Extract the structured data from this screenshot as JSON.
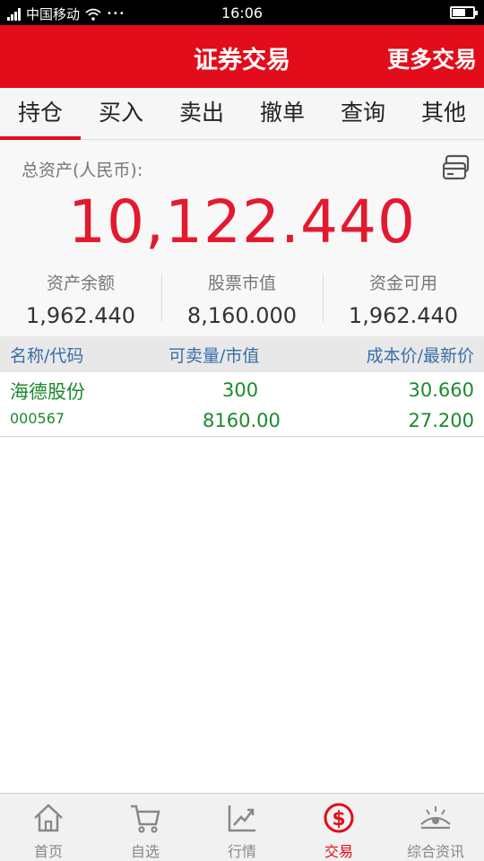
{
  "status_bar": {
    "carrier": "中国移动",
    "dots": "•••",
    "time": "16:06"
  },
  "header": {
    "title": "证券交易",
    "more_label": "更多交易"
  },
  "tabs": [
    {
      "label": "持仓",
      "active": true
    },
    {
      "label": "买入"
    },
    {
      "label": "卖出"
    },
    {
      "label": "撤单"
    },
    {
      "label": "查询"
    },
    {
      "label": "其他"
    }
  ],
  "summary": {
    "total_label": "总资产(人民币):",
    "total_value": "10,122.440",
    "stats": [
      {
        "label": "资产余额",
        "value": "1,962.440"
      },
      {
        "label": "股票市值",
        "value": "8,160.000"
      },
      {
        "label": "资金可用",
        "value": "1,962.440"
      }
    ]
  },
  "table": {
    "headers": [
      "名称/代码",
      "可卖量/市值",
      "成本价/最新价"
    ],
    "rows": [
      {
        "name": "海德股份",
        "code": "000567",
        "sellable": "300",
        "market_value": "8160.00",
        "cost_price": "30.660",
        "latest_price": "27.200"
      }
    ]
  },
  "bottom_nav": [
    {
      "label": "首页",
      "icon": "home-icon"
    },
    {
      "label": "自选",
      "icon": "cart-icon"
    },
    {
      "label": "行情",
      "icon": "trend-icon"
    },
    {
      "label": "交易",
      "icon": "dollar-icon",
      "active": true
    },
    {
      "label": "综合资讯",
      "icon": "eye-icon"
    }
  ],
  "colors": {
    "brand_red": "#e30c1a",
    "value_red": "#e3192e",
    "gain_green": "#1c8a2e",
    "header_blue": "#3a6ea8"
  }
}
